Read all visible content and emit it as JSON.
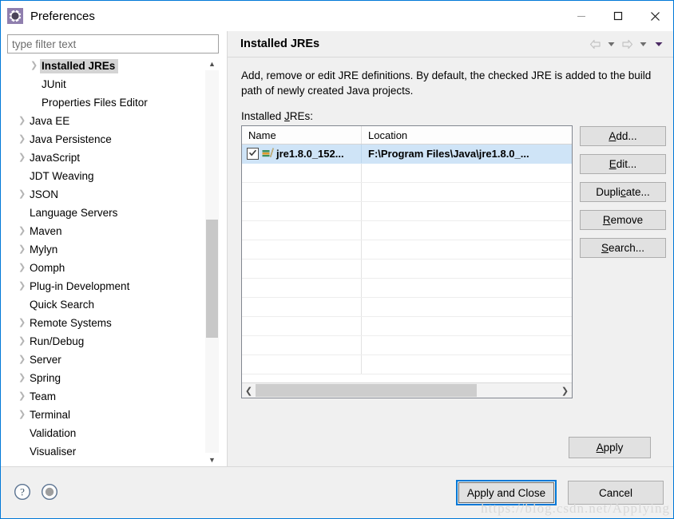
{
  "window": {
    "title": "Preferences",
    "icon": "preferences-gear-icon",
    "accent_color": "#0078d7",
    "controls": {
      "minimize": "minimize-icon",
      "maximize": "maximize-icon",
      "close": "close-icon"
    }
  },
  "sidebar": {
    "filter": {
      "placeholder": "type filter text",
      "value": ""
    },
    "items": [
      {
        "label": "Installed JREs",
        "expandable": true,
        "child": true,
        "selected": true
      },
      {
        "label": "JUnit",
        "expandable": false,
        "child": true,
        "selected": false
      },
      {
        "label": "Properties Files Editor",
        "expandable": false,
        "child": true,
        "selected": false
      },
      {
        "label": "Java EE",
        "expandable": true,
        "child": false,
        "selected": false
      },
      {
        "label": "Java Persistence",
        "expandable": true,
        "child": false,
        "selected": false
      },
      {
        "label": "JavaScript",
        "expandable": true,
        "child": false,
        "selected": false
      },
      {
        "label": "JDT Weaving",
        "expandable": false,
        "child": false,
        "selected": false
      },
      {
        "label": "JSON",
        "expandable": true,
        "child": false,
        "selected": false
      },
      {
        "label": "Language Servers",
        "expandable": false,
        "child": false,
        "selected": false
      },
      {
        "label": "Maven",
        "expandable": true,
        "child": false,
        "selected": false
      },
      {
        "label": "Mylyn",
        "expandable": true,
        "child": false,
        "selected": false
      },
      {
        "label": "Oomph",
        "expandable": true,
        "child": false,
        "selected": false
      },
      {
        "label": "Plug-in Development",
        "expandable": true,
        "child": false,
        "selected": false
      },
      {
        "label": "Quick Search",
        "expandable": false,
        "child": false,
        "selected": false
      },
      {
        "label": "Remote Systems",
        "expandable": true,
        "child": false,
        "selected": false
      },
      {
        "label": "Run/Debug",
        "expandable": true,
        "child": false,
        "selected": false
      },
      {
        "label": "Server",
        "expandable": true,
        "child": false,
        "selected": false
      },
      {
        "label": "Spring",
        "expandable": true,
        "child": false,
        "selected": false
      },
      {
        "label": "Team",
        "expandable": true,
        "child": false,
        "selected": false
      },
      {
        "label": "Terminal",
        "expandable": true,
        "child": false,
        "selected": false
      },
      {
        "label": "Validation",
        "expandable": false,
        "child": false,
        "selected": false
      },
      {
        "label": "Visualiser",
        "expandable": false,
        "child": false,
        "selected": false
      }
    ]
  },
  "page": {
    "title": "Installed JREs",
    "description": "Add, remove or edit JRE definitions. By default, the checked JRE is added to the build path of newly created Java projects.",
    "table_label": "Installed JREs:",
    "nav": {
      "back": "back-arrow-icon",
      "back_menu": "back-dropdown-icon",
      "forward": "forward-arrow-icon",
      "forward_menu": "forward-dropdown-icon",
      "view_menu": "view-menu-dropdown-icon"
    },
    "table": {
      "columns": [
        "Name",
        "Location"
      ],
      "rows": [
        {
          "checked": true,
          "icon": "jre-library-icon",
          "name": "jre1.8.0_152...",
          "location": "F:\\Program Files\\Java\\jre1.8.0_..."
        }
      ],
      "empty_row_count": 11,
      "hscroll": {
        "left": "scroll-left-icon",
        "right": "scroll-right-icon"
      }
    },
    "side_buttons": [
      {
        "label": "Add...",
        "mnemonic": "A"
      },
      {
        "label": "Edit...",
        "mnemonic": "E"
      },
      {
        "label": "Duplicate...",
        "mnemonic": "c"
      },
      {
        "label": "Remove",
        "mnemonic": "R"
      },
      {
        "label": "Search...",
        "mnemonic": "S"
      }
    ],
    "apply_button": {
      "label": "Apply",
      "mnemonic": "A"
    }
  },
  "footer": {
    "help_icon": "help-question-icon",
    "secondary_icon": "oomph-record-icon",
    "apply_and_close": "Apply and Close",
    "cancel": "Cancel",
    "watermark": "https://blog.csdn.net/Applying"
  }
}
